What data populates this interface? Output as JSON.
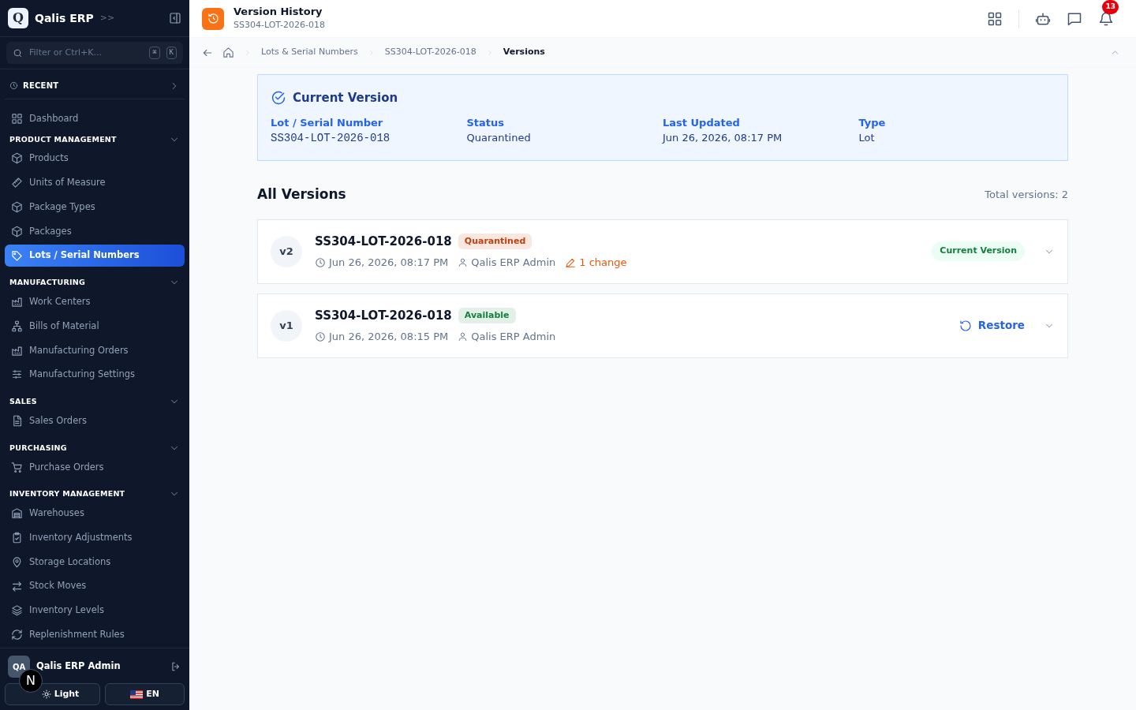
{
  "sidebar": {
    "logo_letter": "Q",
    "app_name": "Qalis ERP",
    "collapse_glyph": ">>",
    "search": {
      "placeholder": "Filter or Ctrl+K...",
      "keys": [
        "⌘",
        "K"
      ]
    },
    "recent": {
      "label": "RECENT",
      "expanded": false
    },
    "top_items": [
      {
        "label": "Dashboard",
        "selected": false
      }
    ],
    "sections": [
      {
        "title": "PRODUCT MANAGEMENT",
        "expanded": true,
        "items": [
          {
            "label": "Products",
            "selected": false
          },
          {
            "label": "Units of Measure",
            "selected": false
          },
          {
            "label": "Package Types",
            "selected": false
          },
          {
            "label": "Packages",
            "selected": false
          },
          {
            "label": "Lots / Serial Numbers",
            "selected": true
          }
        ]
      },
      {
        "title": "MANUFACTURING",
        "expanded": true,
        "items": [
          {
            "label": "Work Centers",
            "selected": false
          },
          {
            "label": "Bills of Material",
            "selected": false
          },
          {
            "label": "Manufacturing Orders",
            "selected": false
          },
          {
            "label": "Manufacturing Settings",
            "selected": false
          }
        ]
      },
      {
        "title": "SALES",
        "expanded": true,
        "items": [
          {
            "label": "Sales Orders",
            "selected": false
          }
        ]
      },
      {
        "title": "PURCHASING",
        "expanded": true,
        "items": [
          {
            "label": "Purchase Orders",
            "selected": false
          }
        ]
      },
      {
        "title": "INVENTORY MANAGEMENT",
        "expanded": true,
        "items": [
          {
            "label": "Warehouses",
            "selected": false
          },
          {
            "label": "Inventory Adjustments",
            "selected": false
          },
          {
            "label": "Storage Locations",
            "selected": false
          },
          {
            "label": "Stock Moves",
            "selected": false
          },
          {
            "label": "Inventory Levels",
            "selected": false
          },
          {
            "label": "Replenishment Rules",
            "selected": false
          }
        ]
      }
    ],
    "user": {
      "initials": "QA",
      "name": "Qalis ERP Admin"
    },
    "dev_badge": "N",
    "theme_button": "Light",
    "language_button": "EN"
  },
  "header": {
    "title": "Version History",
    "subtitle": "SS304-LOT-2026-018",
    "notification_count": "13"
  },
  "breadcrumbs": [
    "Lots & Serial Numbers",
    "SS304-LOT-2026-018",
    "Versions"
  ],
  "current_version": {
    "title": "Current Version",
    "fields": [
      {
        "label": "Lot / Serial Number",
        "value": "SS304-LOT-2026-018",
        "kind": "mono"
      },
      {
        "label": "Status",
        "value": "Quarantined",
        "kind": "text"
      },
      {
        "label": "Last Updated",
        "value": "Jun 26, 2026, 08:17 PM",
        "kind": "text"
      },
      {
        "label": "Type",
        "value": "Lot",
        "kind": "text"
      }
    ]
  },
  "all_versions": {
    "title": "All Versions",
    "total": "Total versions: 2",
    "versions": [
      {
        "tag": "v2",
        "name": "SS304-LOT-2026-018",
        "status": "Quarantined",
        "color": "#c2410c",
        "date": "Jun 26, 2026, 08:17 PM",
        "user": "Qalis ERP Admin",
        "changes": "1 change",
        "action": {
          "kind": "current",
          "label": "Current Version"
        },
        "expanded": false
      },
      {
        "tag": "v1",
        "name": "SS304-LOT-2026-018",
        "status": "Available",
        "color": "#15803d",
        "date": "Jun 26, 2026, 08:15 PM",
        "user": "Qalis ERP Admin",
        "action": {
          "kind": "restore",
          "label": "Restore"
        },
        "expanded": false
      }
    ]
  }
}
